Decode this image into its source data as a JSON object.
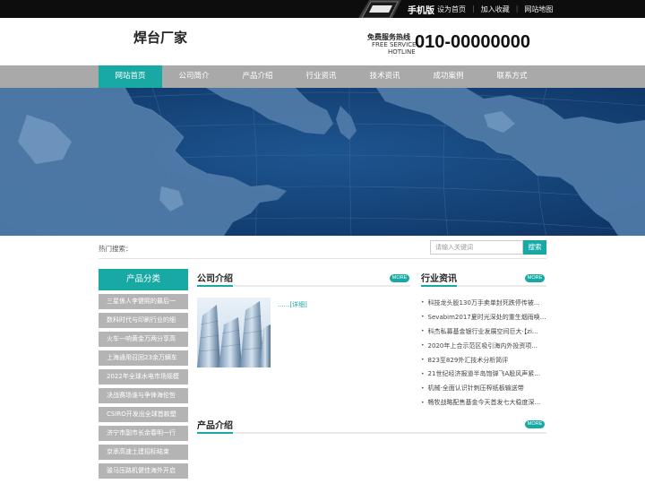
{
  "topbar": {
    "mobile_label": "手机版",
    "links": [
      "设为首页",
      "加入收藏",
      "网站地图"
    ],
    "separator": "|"
  },
  "header": {
    "logo_text": "焊台厂家",
    "hotline_cn": "免费服务热线",
    "hotline_en_1": "FREE SERVICE",
    "hotline_en_2": "HOTLINE",
    "hotline_number": "010-00000000"
  },
  "nav": {
    "items": [
      "网站首页",
      "公司简介",
      "产品介绍",
      "行业资讯",
      "技术资讯",
      "成功案例",
      "联系方式"
    ],
    "active_index": 0
  },
  "search": {
    "hot_label": "热门搜索：",
    "placeholder": "请输入关键词",
    "button_label": "搜索"
  },
  "sidebar": {
    "title": "产品分类",
    "items": [
      "三星係人李健熙的最后一",
      "数科时代与印刷行业的细",
      "火车一响黄金万两分享高",
      "上海通用召回23余万辆车",
      "2022年全球水电市场规模",
      "决战赛场谁与争锋海伦哲",
      "CSIRO开发出全球首款塑",
      "济宁市副市长余春明一行",
      "京承高速土建招标结束",
      "骏马压路机健佳海外开启"
    ]
  },
  "company": {
    "title": "公司介绍",
    "more": "MORE",
    "detail_link": "......[详细]"
  },
  "industry_news": {
    "title": "行业资讯",
    "more": "MORE",
    "bullet": "•",
    "items": [
      "科技龙头股130万手卖单封死跌停传被...",
      "Sevabim2017夏时光深处的重生烟雨唤...",
      "科杰私募基金银行业发展空间巨大·【zi...",
      "2020年上合示范区吸引海内外投资项...",
      "823至829外汇技术分析简评",
      "21世纪经济报道半岛饱弹飞A股风声紧...",
      "机械·全面认识针刺压榨纸板输送带",
      "畅牧战略配售基金今天首发七大稳度深..."
    ]
  },
  "products": {
    "title": "产品介绍",
    "more": "MORE"
  },
  "colors": {
    "accent": "#19a9a4",
    "nav_bg": "#a9a9a9",
    "banner_ocean": "#123e72",
    "sidebar_item": "#b4b4b4",
    "topbar": "#0d0d0d"
  }
}
